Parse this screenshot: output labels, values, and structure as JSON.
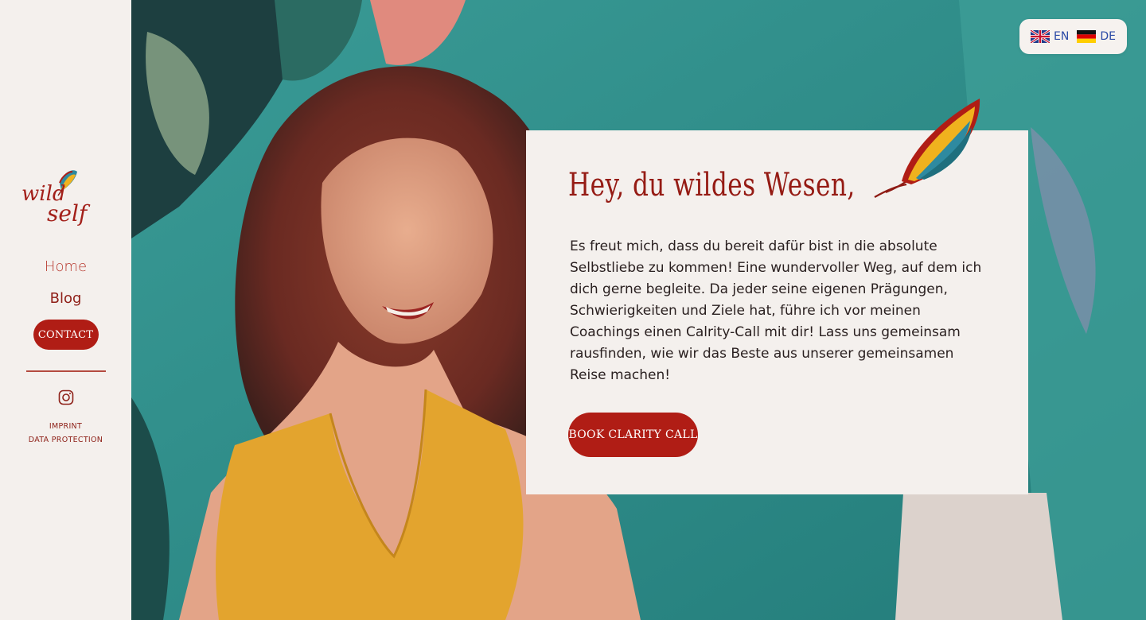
{
  "brand": {
    "logo_text_1": "wild",
    "logo_text_2": "self"
  },
  "nav": {
    "home_label": "Home",
    "blog_label": "Blog",
    "contact_label": "CONTACT"
  },
  "footer": {
    "imprint_label": "IMPRINT",
    "data_protection_label": "DATA PROTECTION"
  },
  "language": {
    "options": [
      {
        "code": "EN",
        "label": "EN"
      },
      {
        "code": "DE",
        "label": "DE"
      }
    ]
  },
  "hero": {
    "heading": "Hey, du wildes Wesen,",
    "body": "Es freut mich, dass du bereit dafür bist in die absolute Selbstliebe zu kommen! Eine wundervoller Weg, auf dem ich dich gerne begleite. Da jeder seine eigenen Prägungen, Schwierigkeiten und Ziele hat, führe ich vor meinen Coachings einen Calrity-Call mit dir! Lass uns gemeinsam rausfinden, wie wir das Beste aus unserer gemeinsamen Reise machen!",
    "cta_label": "BOOK CLARITY CALL"
  },
  "colors": {
    "brand_red": "#b01d15",
    "sidebar_bg": "#f4f0ed",
    "mural_teal": "#2f8d8a"
  }
}
